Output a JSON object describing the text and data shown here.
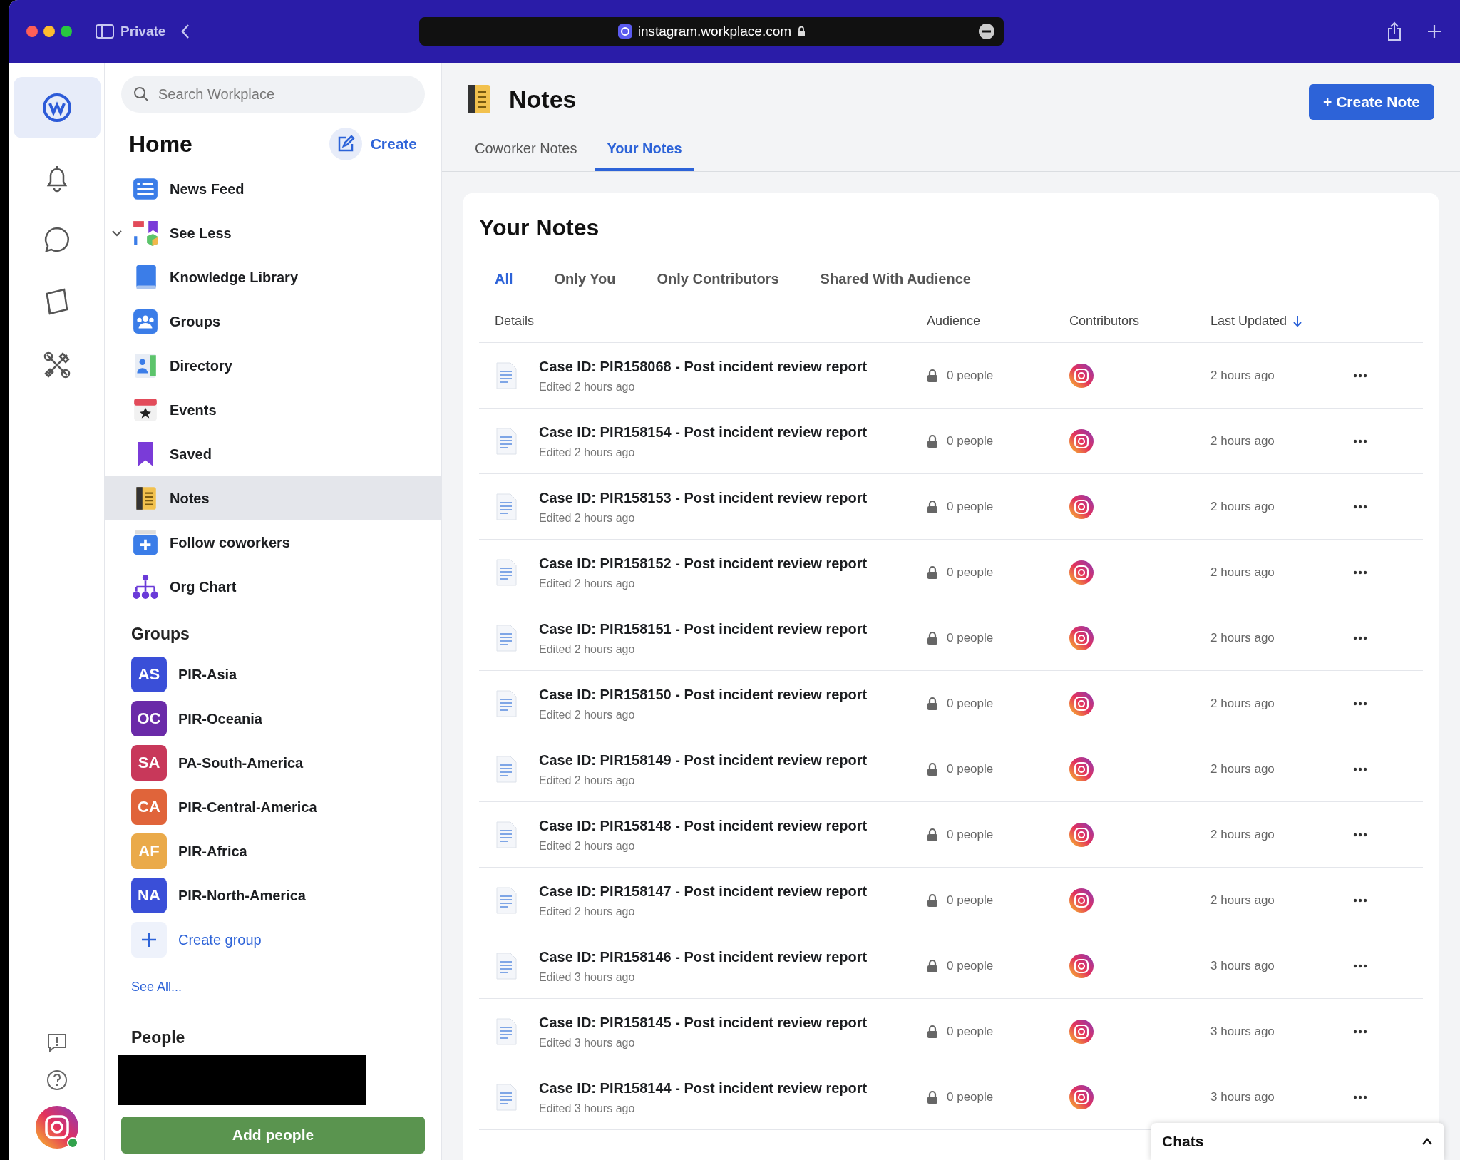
{
  "browser": {
    "mode": "Private",
    "url": "instagram.workplace.com"
  },
  "search": {
    "placeholder": "Search Workplace"
  },
  "home": {
    "title": "Home",
    "create": "Create"
  },
  "nav": [
    {
      "label": "News Feed",
      "kind": "feed",
      "selected": false,
      "expanded": false
    },
    {
      "label": "See Less",
      "kind": "more",
      "selected": false,
      "expanded": true
    },
    {
      "label": "Knowledge Library",
      "kind": "library",
      "selected": false,
      "expanded": false
    },
    {
      "label": "Groups",
      "kind": "groups",
      "selected": false,
      "expanded": false
    },
    {
      "label": "Directory",
      "kind": "directory",
      "selected": false,
      "expanded": false
    },
    {
      "label": "Events",
      "kind": "events",
      "selected": false,
      "expanded": false
    },
    {
      "label": "Saved",
      "kind": "saved",
      "selected": false,
      "expanded": false
    },
    {
      "label": "Notes",
      "kind": "notes",
      "selected": true,
      "expanded": false
    },
    {
      "label": "Follow coworkers",
      "kind": "follow",
      "selected": false,
      "expanded": false
    },
    {
      "label": "Org Chart",
      "kind": "org",
      "selected": false,
      "expanded": false
    }
  ],
  "groups": {
    "title": "Groups",
    "items": [
      {
        "initials": "AS",
        "name": "PIR-Asia",
        "color": "#3a4fd8"
      },
      {
        "initials": "OC",
        "name": "PIR-Oceania",
        "color": "#6a2aa8"
      },
      {
        "initials": "SA",
        "name": "PA-South-America",
        "color": "#c8385a"
      },
      {
        "initials": "CA",
        "name": "PIR-Central-America",
        "color": "#e0643a"
      },
      {
        "initials": "AF",
        "name": "PIR-Africa",
        "color": "#eaaa4a"
      },
      {
        "initials": "NA",
        "name": "PIR-North-America",
        "color": "#3a4fd8"
      }
    ],
    "create": "Create group",
    "see_all": "See All..."
  },
  "people": {
    "title": "People",
    "button": "Add people"
  },
  "page": {
    "title": "Notes",
    "button": "+ Create Note",
    "tabs": [
      {
        "label": "Coworker Notes",
        "selected": false
      },
      {
        "label": "Your Notes",
        "selected": true
      }
    ]
  },
  "card": {
    "title": "Your Notes",
    "filters": [
      {
        "label": "All",
        "selected": true
      },
      {
        "label": "Only You",
        "selected": false
      },
      {
        "label": "Only Contributors",
        "selected": false
      },
      {
        "label": "Shared With Audience",
        "selected": false
      }
    ],
    "columns": [
      "Details",
      "Audience",
      "Contributors",
      "Last Updated"
    ],
    "rows": [
      {
        "title": "Case ID: PIR158068 - Post incident review report",
        "edited": "Edited 2 hours ago",
        "audience": "0 people",
        "updated": "2 hours ago"
      },
      {
        "title": "Case ID: PIR158154 - Post incident review report",
        "edited": "Edited 2 hours ago",
        "audience": "0 people",
        "updated": "2 hours ago"
      },
      {
        "title": "Case ID: PIR158153 - Post incident review report",
        "edited": "Edited 2 hours ago",
        "audience": "0 people",
        "updated": "2 hours ago"
      },
      {
        "title": "Case ID: PIR158152 - Post incident review report",
        "edited": "Edited 2 hours ago",
        "audience": "0 people",
        "updated": "2 hours ago"
      },
      {
        "title": "Case ID: PIR158151 - Post incident review report",
        "edited": "Edited 2 hours ago",
        "audience": "0 people",
        "updated": "2 hours ago"
      },
      {
        "title": "Case ID: PIR158150 - Post incident review report",
        "edited": "Edited 2 hours ago",
        "audience": "0 people",
        "updated": "2 hours ago"
      },
      {
        "title": "Case ID: PIR158149 - Post incident review report",
        "edited": "Edited 2 hours ago",
        "audience": "0 people",
        "updated": "2 hours ago"
      },
      {
        "title": "Case ID: PIR158148 - Post incident review report",
        "edited": "Edited 2 hours ago",
        "audience": "0 people",
        "updated": "2 hours ago"
      },
      {
        "title": "Case ID: PIR158147 - Post incident review report",
        "edited": "Edited 2 hours ago",
        "audience": "0 people",
        "updated": "2 hours ago"
      },
      {
        "title": "Case ID: PIR158146 - Post incident review report",
        "edited": "Edited 3 hours ago",
        "audience": "0 people",
        "updated": "3 hours ago"
      },
      {
        "title": "Case ID: PIR158145 - Post incident review report",
        "edited": "Edited 3 hours ago",
        "audience": "0 people",
        "updated": "3 hours ago"
      },
      {
        "title": "Case ID: PIR158144 - Post incident review report",
        "edited": "Edited 3 hours ago",
        "audience": "0 people",
        "updated": "3 hours ago"
      }
    ]
  },
  "chats": {
    "label": "Chats"
  }
}
